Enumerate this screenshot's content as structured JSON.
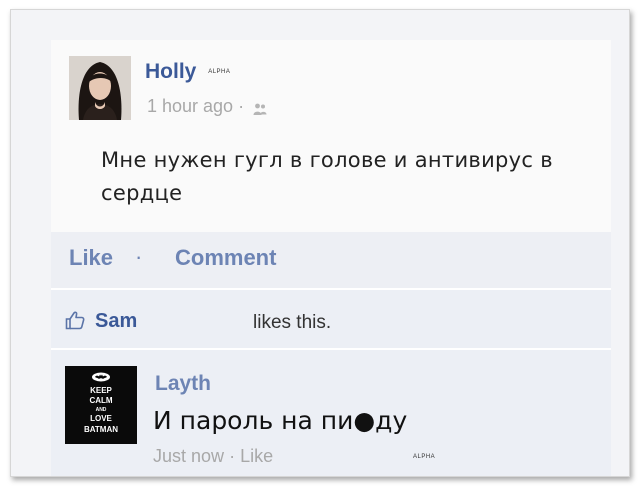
{
  "post": {
    "author": "Holly",
    "badge": "ALPHA",
    "time": "1 hour ago",
    "text": "Мне нужен гугл в голове и антивирус в сердце"
  },
  "actions": {
    "like": "Like",
    "separator": "·",
    "comment": "Comment"
  },
  "likes": {
    "name": "Sam",
    "text": "likes this."
  },
  "comment": {
    "author": "Layth",
    "text": "И пароль на пи●ду",
    "time": "Just now",
    "like": "Like",
    "badge": "ALPHA",
    "avatar_lines": [
      "KEEP",
      "CALM",
      "AND",
      "LOVE",
      "BATMAN"
    ]
  },
  "colors": {
    "link": "#3b5998",
    "muted_link": "#6d84b4",
    "gray": "#a8a8a8",
    "panel": "#edeff4"
  },
  "icons": [
    "thumbs-up-icon",
    "friends-icon",
    "batman-logo-icon"
  ]
}
